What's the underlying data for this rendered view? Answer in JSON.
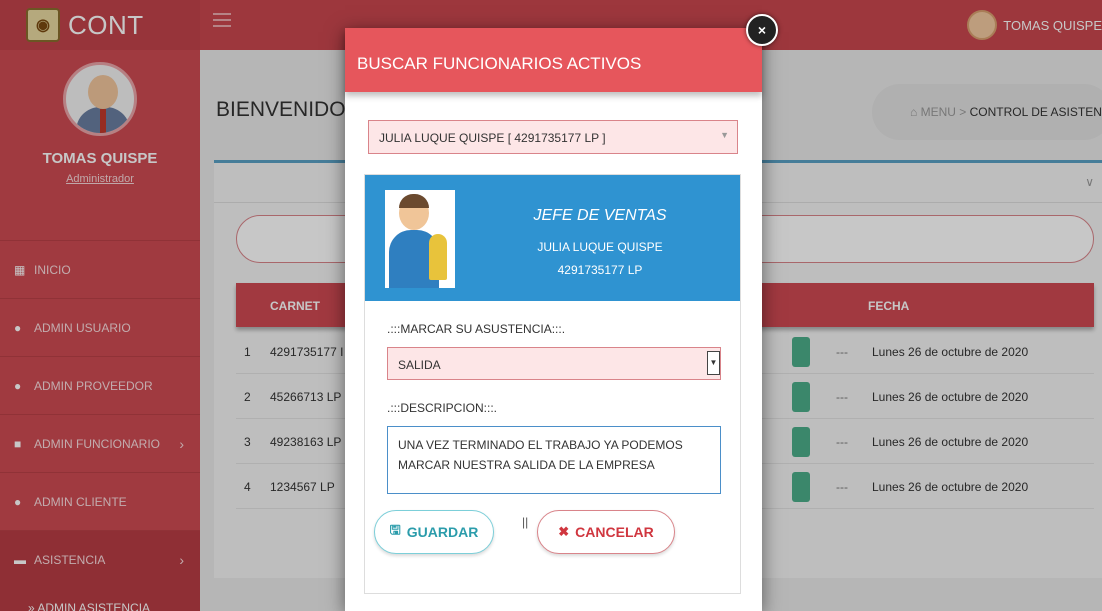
{
  "app": {
    "brand": "CONT",
    "brand_logo_text": "◉"
  },
  "topbar": {
    "user_name": "TOMAS QUISPE"
  },
  "sidebar": {
    "profile_name": "TOMAS QUISPE",
    "profile_role": "Administrador",
    "items": [
      {
        "label": "INICIO",
        "icon": "dashboard-icon"
      },
      {
        "label": "ADMIN USUARIO",
        "icon": "user-icon"
      },
      {
        "label": "ADMIN PROVEEDOR",
        "icon": "users-icon"
      },
      {
        "label": "ADMIN FUNCIONARIO",
        "icon": "briefcase-icon",
        "chevron": "›"
      },
      {
        "label": "ADMIN CLIENTE",
        "icon": "user-plus-icon"
      },
      {
        "label": "ASISTENCIA",
        "icon": "id-card-icon",
        "chevron": "›"
      }
    ],
    "submenu": "» ADMIN ASISTENCIA"
  },
  "main": {
    "welcome": "BIENVENIDO",
    "breadcrumb": {
      "home": "MENU",
      "sep": ">",
      "current": "CONTROL DE ASISTENCIA"
    },
    "table": {
      "headers": [
        "CARNET",
        "FECHA"
      ],
      "rows": [
        {
          "idx": "1",
          "carnet": "4291735177 I",
          "dash": "---",
          "fecha": "Lunes 26 de octubre de 2020"
        },
        {
          "idx": "2",
          "carnet": "45266713 LP",
          "dash": "---",
          "fecha": "Lunes 26 de octubre de 2020"
        },
        {
          "idx": "3",
          "carnet": "49238163 LP",
          "dash": "---",
          "fecha": "Lunes 26 de octubre de 2020"
        },
        {
          "idx": "4",
          "carnet": "1234567 LP",
          "dash": "---",
          "fecha": "Lunes 26 de octubre de 2020"
        }
      ]
    }
  },
  "modal": {
    "title": "BUSCAR FUNCIONARIOS ACTIVOS",
    "close": "×",
    "selected_employee": "JULIA LUQUE QUISPE [ 4291735177 LP ]",
    "card": {
      "position": "JEFE DE VENTAS",
      "name": "JULIA LUQUE QUISPE",
      "id": "4291735177 LP"
    },
    "mark_label": ".:::MARCAR SU ASUSTENCIA:::.",
    "mark_value": "SALIDA",
    "desc_label": ".:::DESCRIPCION:::.",
    "desc_value": "UNA VEZ TERMINADO EL TRABAJO YA PODEMOS MARCAR NUESTRA SALIDA DE LA EMPRESA",
    "save_label": "GUARDAR",
    "separator": "||",
    "cancel_label": "CANCELAR"
  },
  "colors": {
    "accent": "#e6565c",
    "sidebar": "#cd4b53",
    "card": "#2f93d1",
    "save": "#2b9cab",
    "cancel": "#d0363f"
  }
}
